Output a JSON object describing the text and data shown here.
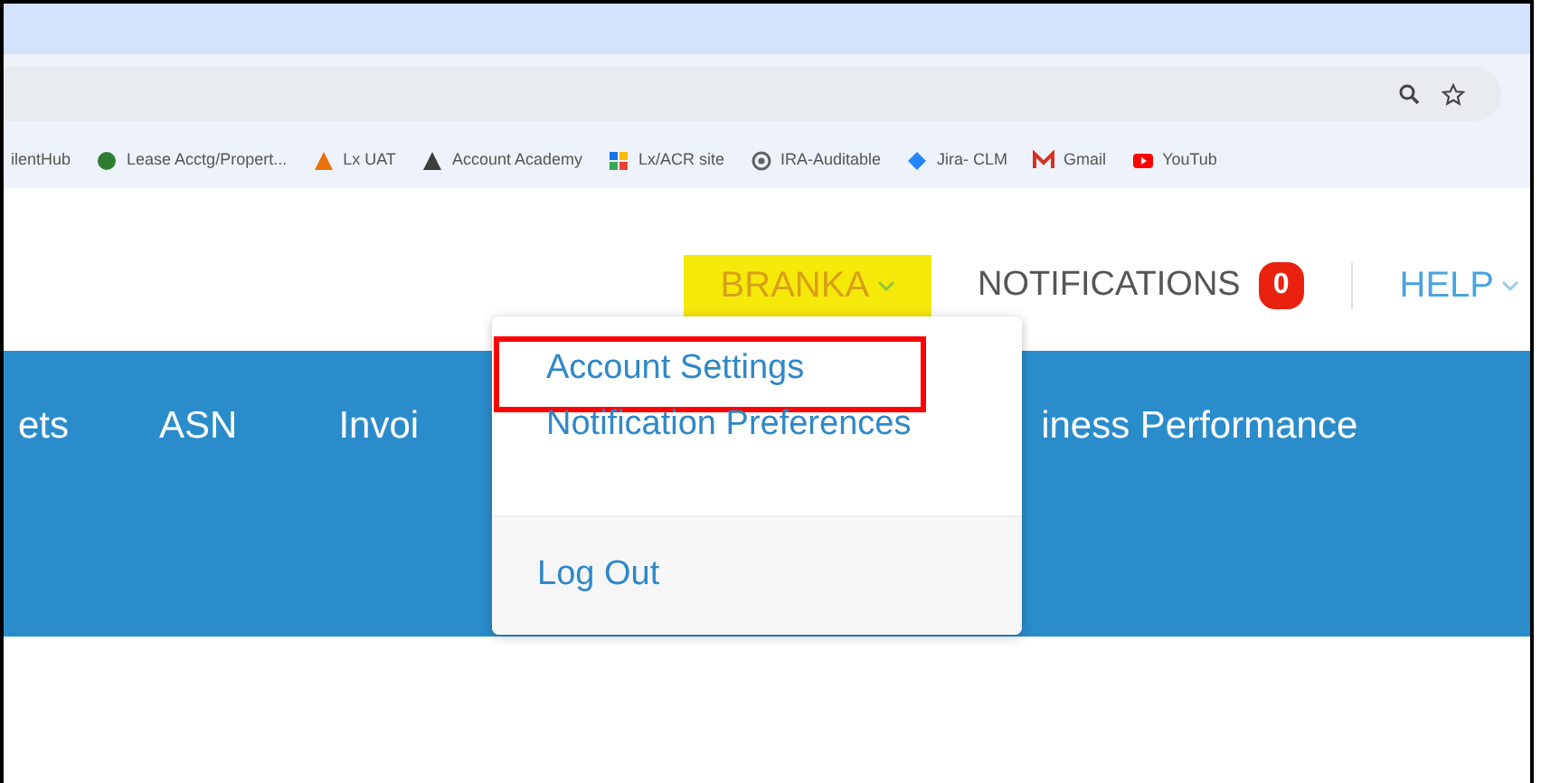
{
  "browser": {
    "bookmarks": [
      {
        "label": "ilentHub",
        "kind": "none"
      },
      {
        "label": "Lease Acctg/Propert...",
        "kind": "circle",
        "color": "#2e7d32"
      },
      {
        "label": "Lx UAT",
        "kind": "triangle",
        "color": "#e8710a"
      },
      {
        "label": "Account Academy",
        "kind": "triangle",
        "color": "#3c3c3c"
      },
      {
        "label": "Lx/ACR site",
        "kind": "grid",
        "color": "#1a73e8"
      },
      {
        "label": "IRA-Auditable",
        "kind": "ring",
        "color": "#5f6368"
      },
      {
        "label": "Jira- CLM",
        "kind": "diamond",
        "color": "#2684ff"
      },
      {
        "label": "Gmail",
        "kind": "mail",
        "color": "#d93025"
      },
      {
        "label": "YouTub",
        "kind": "play",
        "color": "#ff0000"
      }
    ]
  },
  "header": {
    "user_menu": {
      "label": "BRANKA",
      "expanded": true
    },
    "notifications": {
      "label": "NOTIFICATIONS",
      "count": "0"
    },
    "help": {
      "label": "HELP"
    }
  },
  "nav": {
    "items": [
      "ets",
      "ASN",
      "Invoi",
      "iness Performance"
    ]
  },
  "dropdown": {
    "items": [
      {
        "label": "Account Settings",
        "highlighted": true
      },
      {
        "label": "Notification Preferences",
        "highlighted": false
      }
    ],
    "footer_items": [
      {
        "label": "Log Out"
      }
    ]
  }
}
